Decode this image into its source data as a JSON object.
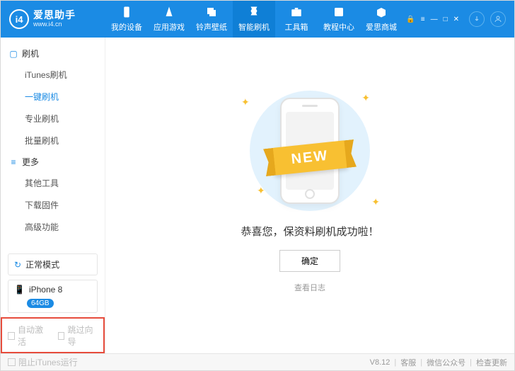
{
  "brand": {
    "name": "爱思助手",
    "url": "www.i4.cn",
    "logo_char": "i4"
  },
  "header": {
    "tabs": [
      {
        "label": "我的设备"
      },
      {
        "label": "应用游戏"
      },
      {
        "label": "铃声壁纸"
      },
      {
        "label": "智能刷机"
      },
      {
        "label": "工具箱"
      },
      {
        "label": "教程中心"
      },
      {
        "label": "爱思商城"
      }
    ],
    "active_tab_index": 3
  },
  "sidebar": {
    "sections": [
      {
        "title": "刷机",
        "items": [
          "iTunes刷机",
          "一键刷机",
          "专业刷机",
          "批量刷机"
        ],
        "active_index": 1
      },
      {
        "title": "更多",
        "items": [
          "其他工具",
          "下载固件",
          "高级功能"
        ],
        "active_index": -1
      }
    ],
    "mode": {
      "label": "正常模式"
    },
    "device": {
      "name": "iPhone 8",
      "storage": "64GB"
    },
    "checkboxes": {
      "auto_activate": "自动激活",
      "skip_guide": "跳过向导"
    }
  },
  "main": {
    "ribbon": "NEW",
    "success": "恭喜您，保资料刷机成功啦！",
    "ok": "确定",
    "view_log": "查看日志"
  },
  "footer": {
    "block_itunes": "阻止iTunes运行",
    "version": "V8.12",
    "support": "客服",
    "wechat": "微信公众号",
    "check_update": "检查更新"
  }
}
